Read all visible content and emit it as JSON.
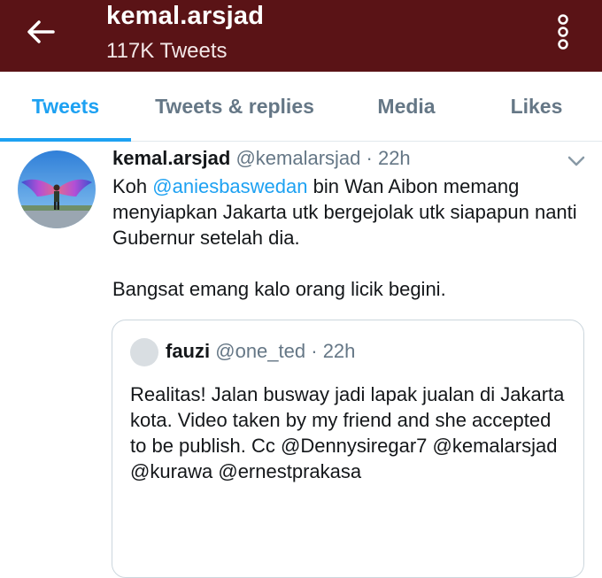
{
  "header": {
    "title": "kemal.arsjad",
    "subtitle": "117K Tweets",
    "back_icon": "arrow-left-icon",
    "more_icon": "more-vertical-icon"
  },
  "tabs": [
    {
      "label": "Tweets",
      "active": true
    },
    {
      "label": "Tweets & replies",
      "active": false
    },
    {
      "label": "Media",
      "active": false
    },
    {
      "label": "Likes",
      "active": false
    }
  ],
  "tweet": {
    "name": "kemal.arsjad",
    "handle": "@kemalarsjad",
    "separator": "·",
    "time": "22h",
    "line1_prefix": "Koh ",
    "line1_mention": "@aniesbaswedan",
    "line1_suffix": " bin Wan Aibon memang",
    "line2": "menyiapkan Jakarta utk bergejolak utk siapapun nanti",
    "line3": "Gubernur setelah dia.",
    "line4": "Bangsat emang kalo orang licik begini.",
    "menu_icon": "chevron-down-icon"
  },
  "quoted_tweet": {
    "name": "fauzi",
    "handle": "@one_ted",
    "separator": "·",
    "time": "22h",
    "line1": "Realitas! Jalan busway jadi lapak jualan di Jakarta",
    "line2": "kota. Video taken by my friend and she accepted",
    "line3": "to be publish. Cc @Dennysiregar7 @kemalarsjad",
    "line4": "@kurawa @ernestprakasa"
  },
  "colors": {
    "header_bg": "#5a1316",
    "accent": "#1da1f2",
    "secondary_text": "#657786",
    "border": "#ccd6dd"
  }
}
